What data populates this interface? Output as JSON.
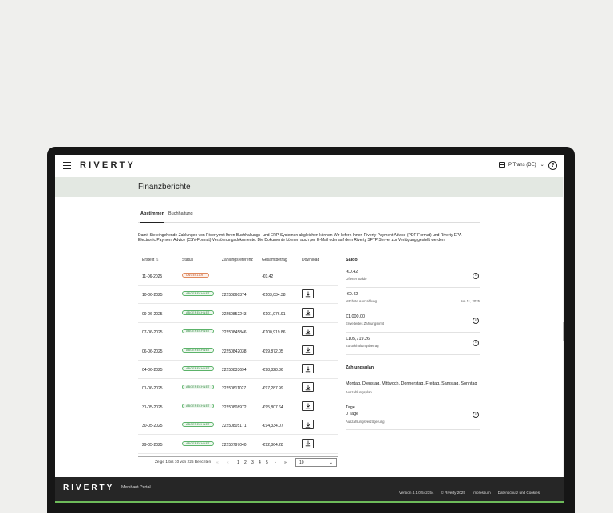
{
  "header": {
    "logo": "RIVERTY",
    "store_label": "P Trans (DE)"
  },
  "page": {
    "title": "Finanzberichte",
    "tabs": [
      {
        "label": "Abstimmen",
        "active": true
      },
      {
        "label": "Buchhaltung",
        "active": false
      }
    ],
    "intro": "Damit Sie eingehende Zahlungen von Riverty mit Ihren Buchhaltungs- und ERP-Systemen abgleichen können Wir liefern Ihnen Riverty Payment Advice (PDF-Format) und Riverty EPA – Electronic Payment Advice (CSV-Format) Versöhnungsdokumente. Die Dokumente können auch per E-Mail oder auf dem Riverty SFTP Server zur Verfügung gestellt werden."
  },
  "table": {
    "headers": [
      "Erstellt",
      "Status",
      "Zahlungsreferenz",
      "Gesamtbetrag",
      "Download"
    ],
    "rows": [
      {
        "date": "11-06-2025",
        "status": "UNGEKLÄRT",
        "status_color": "#c0552b",
        "ref": "",
        "amount": "-€0.42",
        "download": false
      },
      {
        "date": "10-06-2025",
        "status": "ABGERECHNET",
        "status_color": "#2e8a3e",
        "ref": "22250860374",
        "amount": "-€103,034.38",
        "download": true
      },
      {
        "date": "09-06-2025",
        "status": "ABGERECHNET",
        "status_color": "#2e8a3e",
        "ref": "22250852243",
        "amount": "-€101,976.91",
        "download": true
      },
      {
        "date": "07-06-2025",
        "status": "ABGERECHNET",
        "status_color": "#2e8a3e",
        "ref": "22250845846",
        "amount": "-€100,919.86",
        "download": true
      },
      {
        "date": "06-06-2025",
        "status": "ABGERECHNET",
        "status_color": "#2e8a3e",
        "ref": "22250842038",
        "amount": "-€99,872.05",
        "download": true
      },
      {
        "date": "04-06-2025",
        "status": "ABGERECHNET",
        "status_color": "#2e8a3e",
        "ref": "22250833694",
        "amount": "-€98,828.86",
        "download": true
      },
      {
        "date": "01-06-2025",
        "status": "ABGERECHNET",
        "status_color": "#2e8a3e",
        "ref": "22250811027",
        "amount": "-€97,287.99",
        "download": true
      },
      {
        "date": "31-05-2025",
        "status": "ABGERECHNET",
        "status_color": "#2e8a3e",
        "ref": "22250808972",
        "amount": "-€95,807.64",
        "download": true
      },
      {
        "date": "30-05-2025",
        "status": "ABGERECHNET",
        "status_color": "#2e8a3e",
        "ref": "22250805171",
        "amount": "-€94,334.07",
        "download": true
      },
      {
        "date": "29-05-2025",
        "status": "ABGERECHNET",
        "status_color": "#2e8a3e",
        "ref": "22250797040",
        "amount": "-€92,864.28",
        "download": true
      }
    ]
  },
  "pagination": {
    "summary": "Zeige 1 bis 10 von 225 Berichten",
    "pages": [
      "1",
      "2",
      "3",
      "4",
      "5"
    ],
    "page_size": "10"
  },
  "sidebar": {
    "saldo_title": "Saldo",
    "saldo": [
      {
        "value": "-€0.42",
        "label": "Offener Saldo",
        "right": "",
        "info": true
      },
      {
        "value": "-€0.42",
        "label": "Nächste Auszahlung",
        "right": "Jun 11, 2025",
        "info": false
      },
      {
        "value": "€1,000.00",
        "label": "Erweitertes Zahlungslimit",
        "right": "",
        "info": true
      },
      {
        "value": "€105,719.26",
        "label": "Zurückhaltungsbetrag",
        "right": "",
        "info": true
      }
    ],
    "plan_title": "Zahlungsplan",
    "plan": [
      {
        "value": "Montag, Dienstag, Mittwoch, Donnerstag, Freitag, Samstag, Sonntag",
        "label": "Auszahlungsplan",
        "info": false
      },
      {
        "value": "Tage",
        "value2": "0 Tage",
        "label": "Auszahlungsverzögerung",
        "info": true
      }
    ]
  },
  "footer": {
    "logo": "RIVERTY",
    "portal": "Merchant Portal",
    "links": [
      "Version 4.1.0.542354",
      "© Riverty 2025",
      "Impressum",
      "Datenschutz und Cookies"
    ]
  }
}
